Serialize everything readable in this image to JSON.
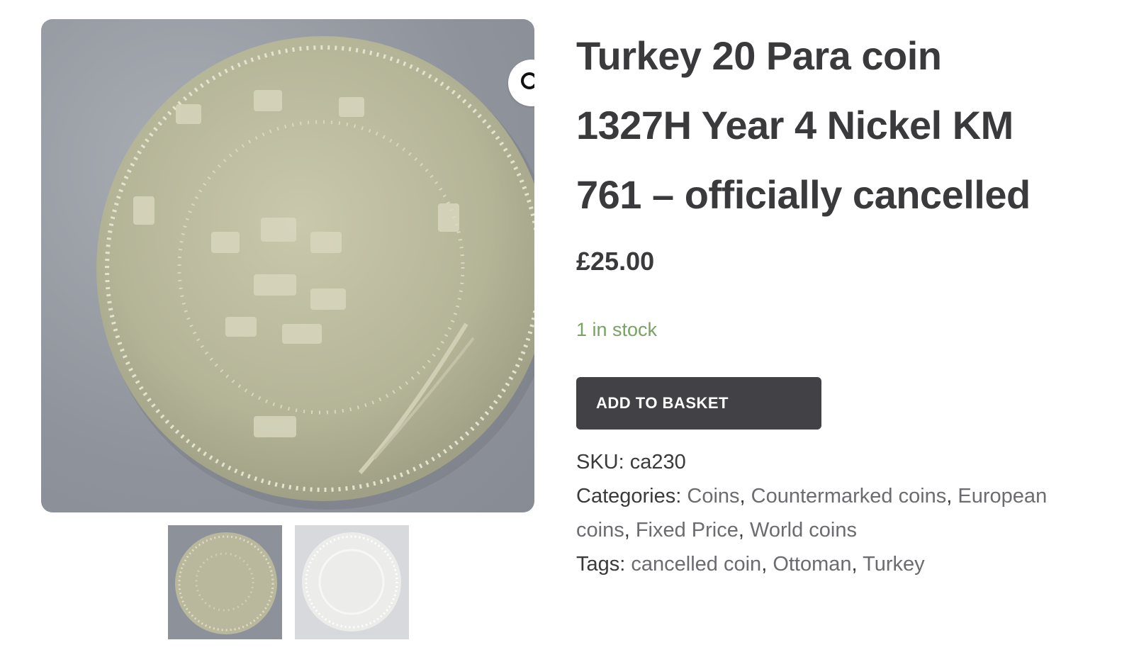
{
  "product": {
    "title_line1": "Turkey 20 Para coin",
    "title_line2": "1327H Year 4 Nickel KM",
    "title_line3": "761 – officially cancelled",
    "price": "£25.00",
    "stock": "1 in stock",
    "add_to_basket": "ADD TO BASKET",
    "sku_label": "SKU:",
    "sku_value": "ca230",
    "categories_label": "Categories:",
    "categories": [
      "Coins",
      "Countermarked coins",
      "European coins",
      "Fixed Price",
      "World coins"
    ],
    "tags_label": "Tags:",
    "tags": [
      "cancelled coin",
      "Ottoman",
      "Turkey"
    ]
  },
  "gallery": {
    "zoom_icon": "magnifier-icon",
    "thumbnails": [
      "coin-obverse-thumbnail",
      "coin-reverse-thumbnail"
    ]
  },
  "colors": {
    "text": "#3a3a3c",
    "stock_green": "#77a464",
    "button_bg": "#414146",
    "link_gray": "#6b6b70"
  }
}
